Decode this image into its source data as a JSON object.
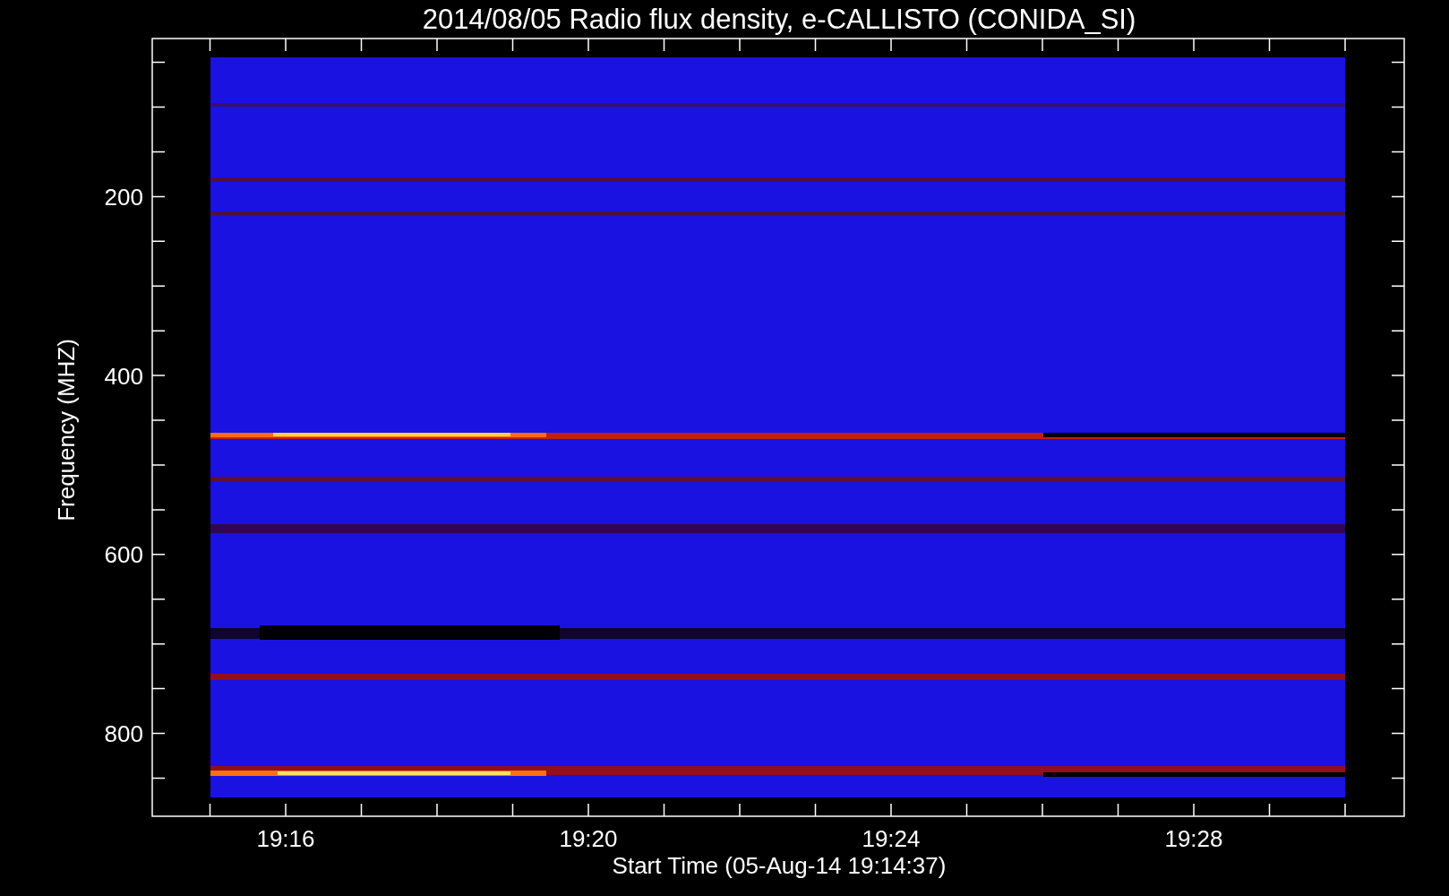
{
  "plot": {
    "title": "2014/08/05  Radio flux density, e-CALLISTO (CONIDA_SI)",
    "ylabel": "Frequency (MHZ)",
    "xlabel": "Start Time (05-Aug-14 19:14:37)",
    "yticks": [
      "200",
      "400",
      "600",
      "800"
    ],
    "xticks": [
      "19:16",
      "19:20",
      "19:24",
      "19:28"
    ],
    "kind": "picture"
  }
}
